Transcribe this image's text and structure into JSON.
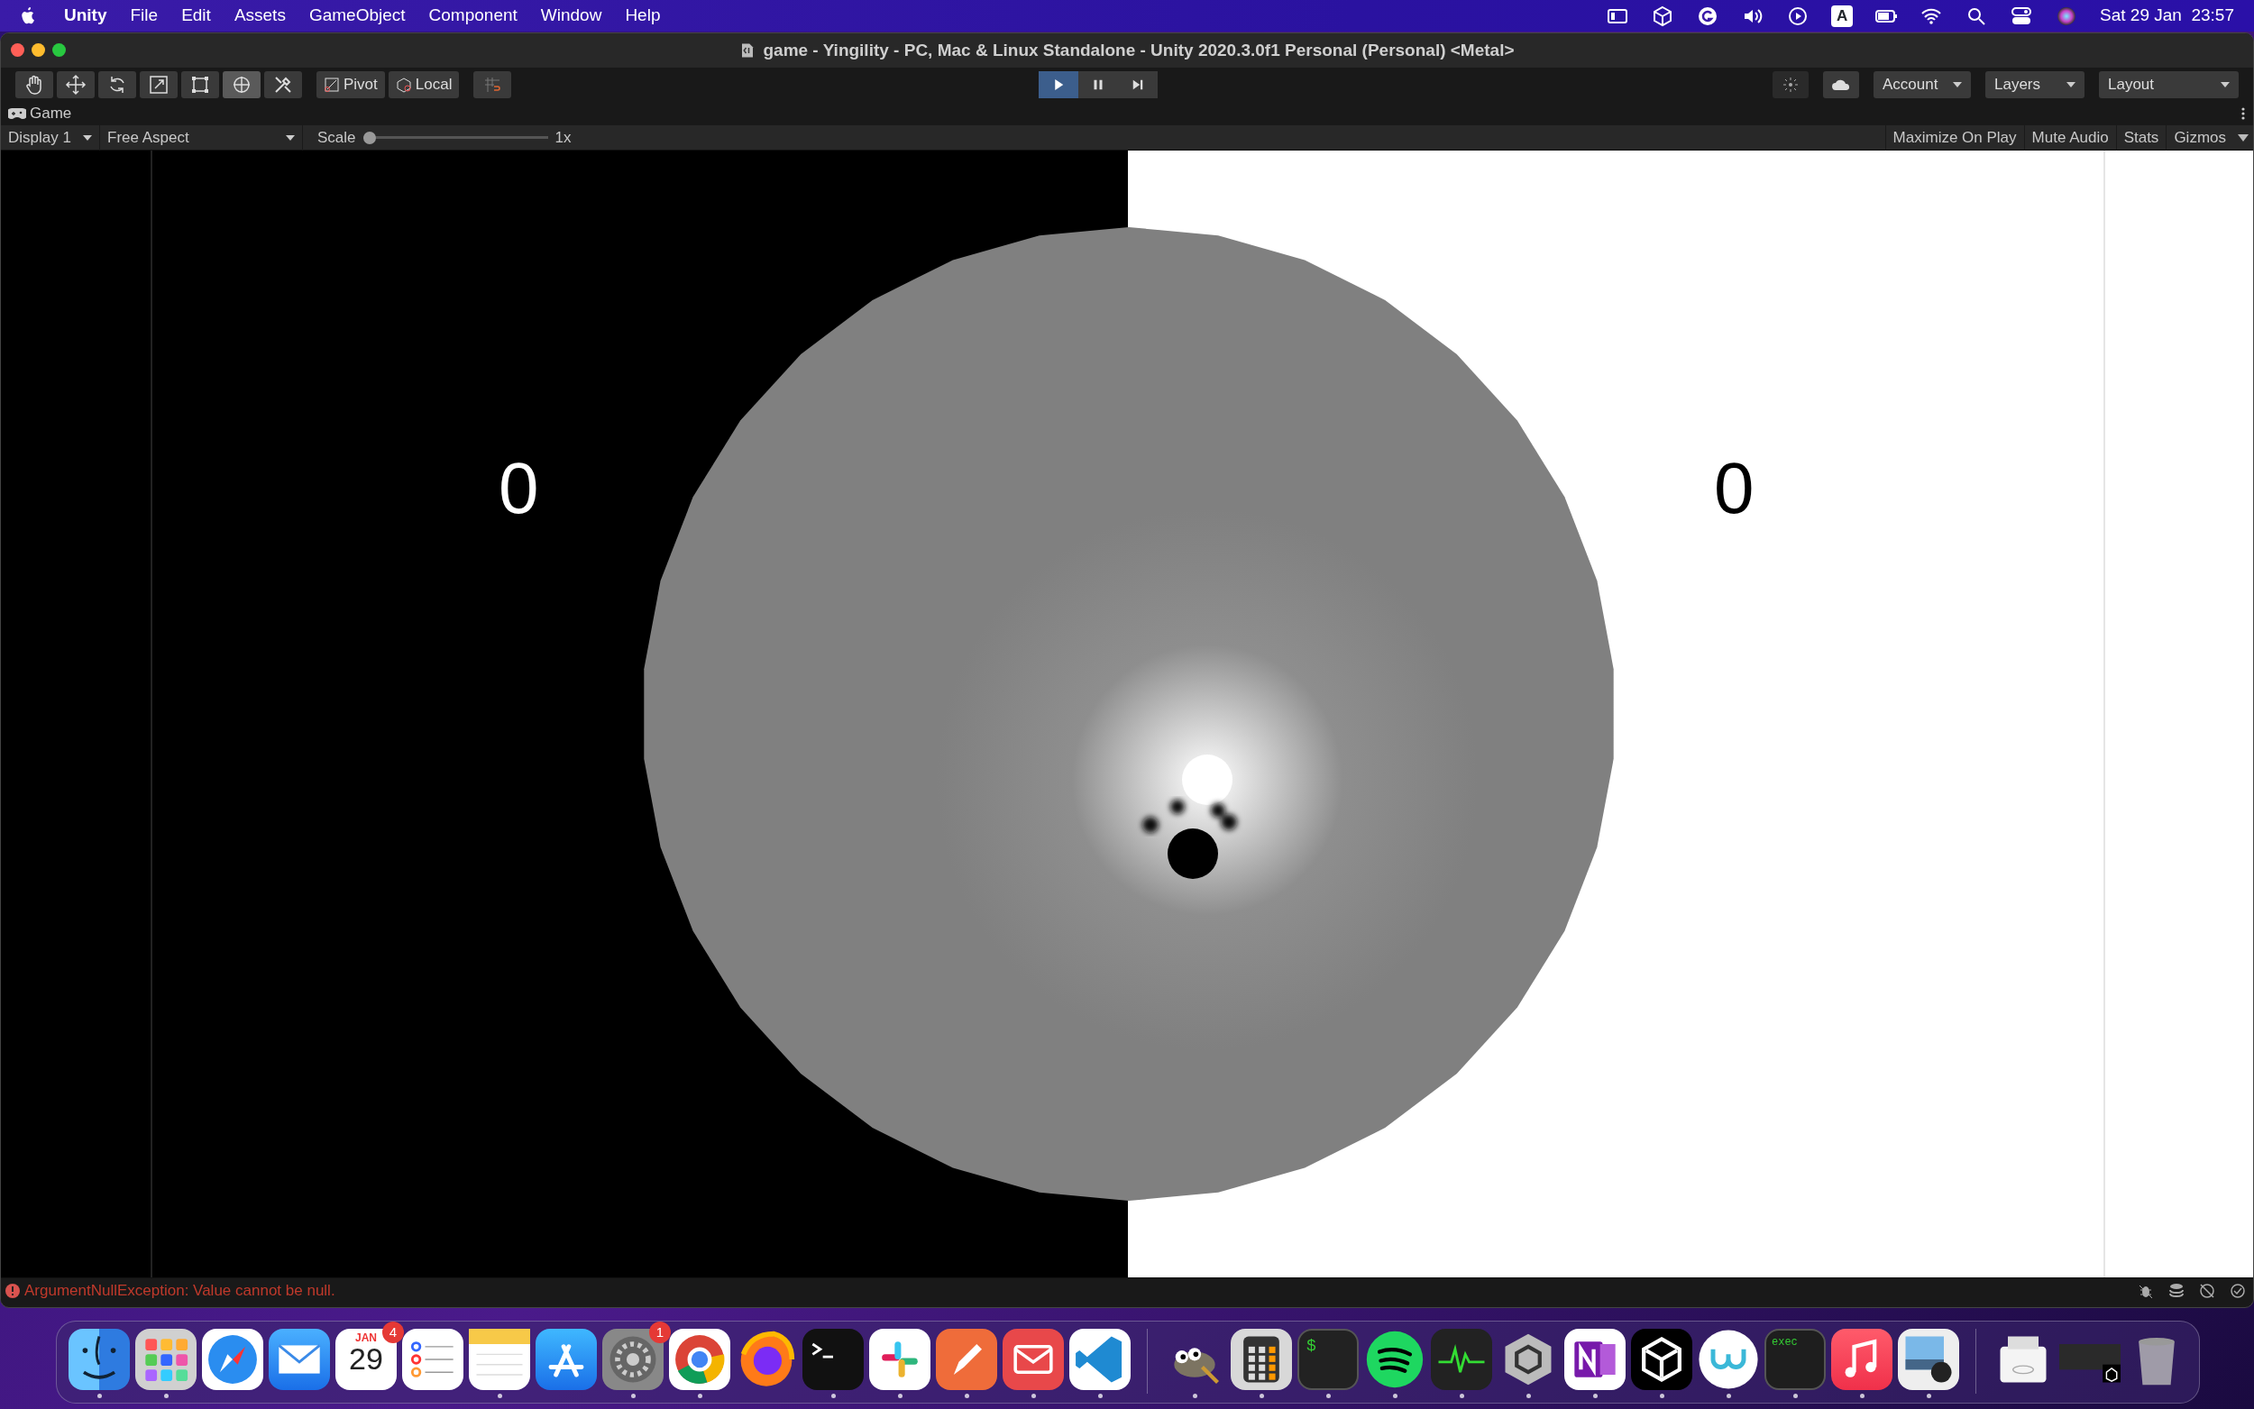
{
  "menubar": {
    "app": "Unity",
    "menus": [
      "File",
      "Edit",
      "Assets",
      "GameObject",
      "Component",
      "Window",
      "Help"
    ],
    "status_icons": [
      {
        "kind": "display"
      },
      {
        "kind": "cube"
      },
      {
        "kind": "grammar"
      },
      {
        "kind": "volume"
      },
      {
        "kind": "play"
      },
      {
        "kind": "input",
        "label": "A"
      },
      {
        "kind": "battery"
      },
      {
        "kind": "wifi"
      },
      {
        "kind": "search"
      },
      {
        "kind": "controls"
      },
      {
        "kind": "orb"
      }
    ],
    "clock": "Sat 29 Jan  23:57"
  },
  "window": {
    "title": "game - Yingility - PC, Mac & Linux Standalone - Unity 2020.3.0f1 Personal (Personal) <Metal>"
  },
  "toolbar": {
    "tools": [
      {
        "kind": "hand",
        "selected": false
      },
      {
        "kind": "move",
        "selected": false
      },
      {
        "kind": "rotate",
        "selected": false
      },
      {
        "kind": "scale",
        "selected": false
      },
      {
        "kind": "rect",
        "selected": false
      },
      {
        "kind": "transform",
        "selected": true
      },
      {
        "kind": "custom",
        "selected": false
      }
    ],
    "pivot": "Pivot",
    "local": "Local",
    "playback": [
      {
        "kind": "play",
        "selected": true
      },
      {
        "kind": "pause",
        "selected": false
      },
      {
        "kind": "step",
        "selected": false
      }
    ],
    "dropdowns": [
      "Account",
      "Layers",
      "Layout"
    ]
  },
  "game_tab": {
    "label": "Game"
  },
  "game_bar": {
    "display": "Display 1",
    "aspect": "Free Aspect",
    "scale_label": "Scale",
    "scale": {
      "level": 0.0
    },
    "scale_value": "1x",
    "toggles": [
      {
        "label": "Maximize On Play",
        "selected": false
      },
      {
        "label": "Mute Audio",
        "selected": false
      },
      {
        "label": "Stats",
        "selected": false
      },
      {
        "label": "Gizmos",
        "selected": false
      }
    ]
  },
  "game_view": {
    "left_score": "0",
    "right_score": "0"
  },
  "status_bar": {
    "message": "ArgumentNullException: Value cannot be null."
  },
  "dock": [
    {
      "kind": "finder",
      "running": true
    },
    {
      "kind": "launchpad",
      "running": true
    },
    {
      "kind": "safari",
      "running": false
    },
    {
      "kind": "mail",
      "running": false
    },
    {
      "kind": "calendar",
      "month": "JAN",
      "day": "29",
      "badge": "4",
      "running": false
    },
    {
      "kind": "reminders",
      "running": false
    },
    {
      "kind": "notes",
      "running": true
    },
    {
      "kind": "appstore",
      "running": false
    },
    {
      "kind": "settings",
      "badge": "1",
      "running": true
    },
    {
      "kind": "chrome",
      "running": true
    },
    {
      "kind": "firefox",
      "running": false
    },
    {
      "kind": "terminal",
      "running": true
    },
    {
      "kind": "slack",
      "running": true
    },
    {
      "kind": "postman",
      "running": true
    },
    {
      "kind": "redmail",
      "running": true
    },
    {
      "kind": "vscode",
      "running": true
    },
    {
      "kind": "separator"
    },
    {
      "kind": "gimp",
      "running": true
    },
    {
      "kind": "calculator",
      "running": true
    },
    {
      "kind": "iterm",
      "label": "$",
      "running": true
    },
    {
      "kind": "spotify",
      "running": true
    },
    {
      "kind": "activity",
      "running": true
    },
    {
      "kind": "unityhub",
      "running": true
    },
    {
      "kind": "onenote",
      "running": true
    },
    {
      "kind": "unity",
      "running": true
    },
    {
      "kind": "wapp",
      "running": true
    },
    {
      "kind": "exec",
      "label": "exec",
      "running": true
    },
    {
      "kind": "music",
      "running": true
    },
    {
      "kind": "preview",
      "running": true
    },
    {
      "kind": "separator"
    },
    {
      "kind": "scanner",
      "running": false
    },
    {
      "kind": "thumbnail",
      "running": false
    },
    {
      "kind": "trash",
      "running": false
    }
  ]
}
